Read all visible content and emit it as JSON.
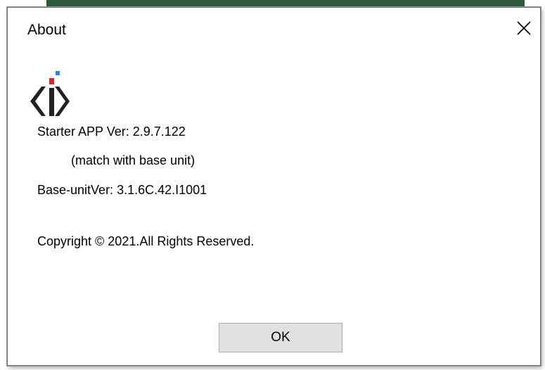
{
  "dialog": {
    "title": "About",
    "close_icon": "close-icon",
    "logo_icon": "app-logo",
    "lines": {
      "app_version": "Starter APP Ver: 2.9.7.122",
      "match_note": "(match with base unit)",
      "base_version": "Base-unitVer: 3.1.6C.42.I1001",
      "copyright": "Copyright © 2021.All Rights Reserved."
    },
    "ok_label": "OK"
  },
  "colors": {
    "logo_dark": "#222222",
    "logo_red": "#d9262b",
    "logo_blue": "#2e86d6",
    "button_bg": "#e1e1e1",
    "button_border": "#adadad",
    "background_strip": "#2f5a3a"
  }
}
